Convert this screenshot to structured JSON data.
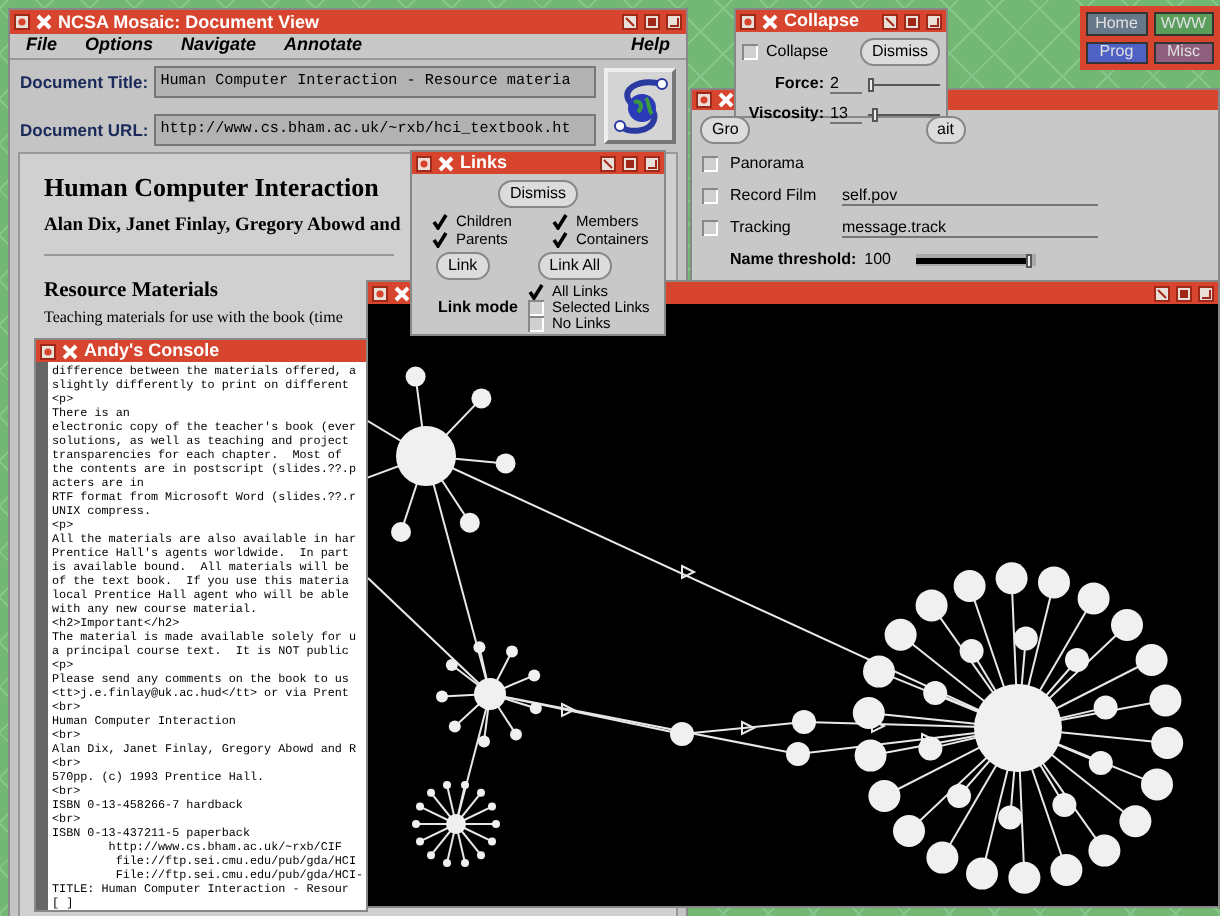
{
  "mosaic": {
    "title": "NCSA Mosaic: Document View",
    "menu": [
      "File",
      "Options",
      "Navigate",
      "Annotate"
    ],
    "help": "Help",
    "title_label": "Document Title:",
    "title_value": "Human Computer Interaction - Resource materia",
    "url_label": "Document URL:",
    "url_value": "http://www.cs.bham.ac.uk/~rxb/hci_textbook.ht",
    "heading": "Human Computer Interaction",
    "authors": "Alan Dix, Janet Finlay, Gregory Abowd and",
    "section": "Resource Materials",
    "paragraph": "Teaching materials for use with the book (time"
  },
  "collapse": {
    "title": "Collapse",
    "option": {
      "label": "Collapse",
      "checked": false
    },
    "dismiss": "Dismiss",
    "sliders": [
      {
        "label": "Force:",
        "reading": "2",
        "level": 0.05
      },
      {
        "label": "Viscosity:",
        "reading": "13",
        "level": 0.12
      }
    ]
  },
  "nav_buttons": [
    {
      "label": "Home",
      "color": "#66788a"
    },
    {
      "label": "WWW",
      "color": "#5a9e5c"
    },
    {
      "label": "Prog",
      "color": "#4f62c4"
    },
    {
      "label": "Misc",
      "color": "#8e5f7e"
    }
  ],
  "viewer": {
    "buttons": [
      "Gro",
      "ait"
    ],
    "toggles": [
      {
        "label": "Panorama",
        "checked": false
      },
      {
        "label": "Record Film",
        "checked": false,
        "value": "self.pov"
      },
      {
        "label": "Tracking",
        "checked": false,
        "value": "message.track"
      }
    ],
    "threshold": {
      "label": "Name threshold:",
      "reading": "100",
      "level": 0.95
    }
  },
  "links": {
    "title": "Links",
    "dismiss": "Dismiss",
    "options": [
      {
        "label": "Children",
        "checked": true
      },
      {
        "label": "Members",
        "checked": true
      },
      {
        "label": "Parents",
        "checked": true
      },
      {
        "label": "Containers",
        "checked": true
      }
    ],
    "buttons": [
      "Link",
      "Link All"
    ],
    "mode_label": "Link mode",
    "modes": [
      {
        "label": "All Links",
        "selected": true
      },
      {
        "label": "Selected Links",
        "selected": false
      },
      {
        "label": "No Links",
        "selected": false
      }
    ]
  },
  "console": {
    "title": "Andy's Console",
    "lines": [
      "difference between the materials offered, a",
      "slightly differently to print on different",
      "<p>",
      "There is an",
      "electronic copy of the teacher's book (ever",
      "solutions, as well as teaching and project",
      "transparencies for each chapter.  Most of",
      "the contents are in postscript (slides.??.p",
      "acters are in",
      "RTF format from Microsoft Word (slides.??.r",
      "UNIX compress.",
      "<p>",
      "All the materials are also available in har",
      "Prentice Hall's agents worldwide.  In part",
      "is available bound.  All materials will be",
      "of the text book.  If you use this materia",
      "local Prentice Hall agent who will be able",
      "with any new course material.",
      "<h2>Important</h2>",
      "The material is made available solely for u",
      "a principal course text.  It is NOT public",
      "<p>",
      "Please send any comments on the book to us",
      "<tt>j.e.finlay@uk.ac.hud</tt> or via Prent",
      "<br>",
      "Human Computer Interaction",
      "<br>",
      "Alan Dix, Janet Finlay, Gregory Abowd and R",
      "<br>",
      "570pp. (c) 1993 Prentice Hall.",
      "<br>",
      "ISBN 0-13-458266-7 hardback",
      "<br>",
      "ISBN 0-13-437211-5 paperback",
      "        http://www.cs.bham.ac.uk/~rxb/CIF",
      "         file://ftp.sei.cmu.edu/pub/gda/HCI",
      "         File://ftp.sei.cmu.edu/pub/gda/HCI-",
      "TITLE: Human Computer Interaction - Resour",
      "[ ]"
    ]
  }
}
